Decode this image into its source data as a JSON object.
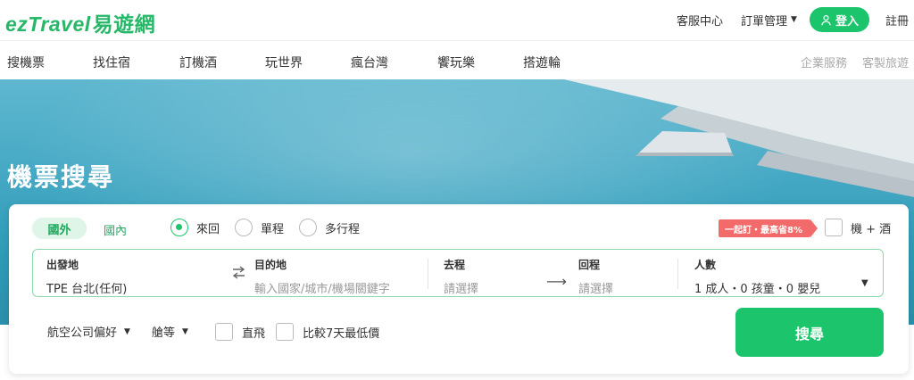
{
  "header": {
    "logo_text": "ezTravel",
    "logo_cn": "易遊網",
    "customer_service": "客服中心",
    "order_manage": "訂單管理",
    "login": "登入",
    "register": "註冊"
  },
  "nav": {
    "items": [
      "搜機票",
      "找住宿",
      "訂機酒",
      "玩世界",
      "瘋台灣",
      "饗玩樂",
      "搭遊輪"
    ],
    "side": [
      "企業服務",
      "客製旅遊"
    ]
  },
  "hero": {
    "title": "機票搜尋"
  },
  "search": {
    "tab_international": "國外",
    "tab_domestic": "國內",
    "trip_types": [
      "來回",
      "單程",
      "多行程"
    ],
    "selected_trip": "來回",
    "promo": "一起訂・最高省8%",
    "combo_label": "機 + 酒",
    "from_label": "出發地",
    "from_value": "TPE 台北(任何)",
    "to_label": "目的地",
    "to_placeholder": "輸入國家/城市/機場關鍵字",
    "depart_label": "去程",
    "depart_placeholder": "請選擇",
    "return_label": "回程",
    "return_placeholder": "請選擇",
    "pax_label": "人數",
    "pax_value": "1 成人・0 孩童・0 嬰兒",
    "airline_pref": "航空公司偏好",
    "cabin": "艙等",
    "direct": "直飛",
    "compare": "比較7天最低價",
    "submit": "搜尋"
  },
  "colors": {
    "brand": "#1cc46b",
    "promo": "#f26a6a",
    "sky": "#44a8c4"
  }
}
